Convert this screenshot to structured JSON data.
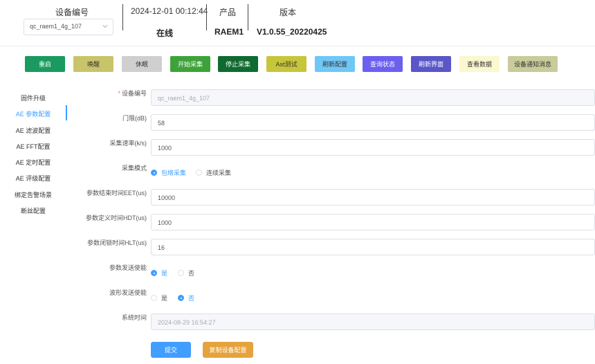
{
  "header": {
    "device_label": "设备编号",
    "device_select_value": "qc_raem1_4g_107",
    "timestamp": "2024-12-01 00:12:44",
    "status": "在线",
    "product_label": "产品",
    "product_value": "RAEM1",
    "version_label": "版本",
    "version_value": "V1.0.55_20220425"
  },
  "toolbar": {
    "buttons": [
      {
        "label": "重启",
        "bg": "#1a9a5f",
        "fg": "#ffffff"
      },
      {
        "label": "唤醒",
        "bg": "#c9c46a",
        "fg": "#333333"
      },
      {
        "label": "休眠",
        "bg": "#cfcfcf",
        "fg": "#333333"
      },
      {
        "label": "开始采集",
        "bg": "#3ea23a",
        "fg": "#ffffff"
      },
      {
        "label": "停止采集",
        "bg": "#0f6a2f",
        "fg": "#ffffff"
      },
      {
        "label": "Ast测试",
        "bg": "#c7c63a",
        "fg": "#333333"
      },
      {
        "label": "刷新配置",
        "bg": "#6fc7f6",
        "fg": "#333333"
      },
      {
        "label": "查询状态",
        "bg": "#6b5ff0",
        "fg": "#ffffff"
      },
      {
        "label": "刷新界面",
        "bg": "#5a56c8",
        "fg": "#ffffff"
      },
      {
        "label": "查看数据",
        "bg": "#fbf8cf",
        "fg": "#333333"
      },
      {
        "label": "设备通知消息",
        "bg": "#c8cb9a",
        "fg": "#333333"
      }
    ]
  },
  "sidebar": {
    "items": [
      {
        "label": "固件升级"
      },
      {
        "label": "AE 参数配置"
      },
      {
        "label": "AE 滤波配置"
      },
      {
        "label": "AE FFT配置"
      },
      {
        "label": "AE 定时配置"
      },
      {
        "label": "AE 评级配置"
      },
      {
        "label": "绑定告警场景"
      },
      {
        "label": "断丝配置"
      }
    ],
    "active_index": 1
  },
  "form": {
    "device_no": {
      "label": "设备编号",
      "value": "qc_raem1_4g_107"
    },
    "threshold": {
      "label": "门限(dB)",
      "value": "58"
    },
    "sample_rate": {
      "label": "采集速率(k/s)",
      "value": "1000"
    },
    "mode": {
      "label": "采集模式",
      "option_a": "包络采集",
      "option_b": "连续采集",
      "selected": "a"
    },
    "eet": {
      "label": "参数结束时间EET(us)",
      "value": "10000"
    },
    "hdt": {
      "label": "参数定义时间HDT(us)",
      "value": "1000"
    },
    "hlt": {
      "label": "参数闭锁时间HLT(us)",
      "value": "16"
    },
    "param_send": {
      "label": "参数发送使能",
      "option_a": "是",
      "option_b": "否",
      "selected": "a"
    },
    "wave_send": {
      "label": "波形发送使能",
      "option_a": "是",
      "option_b": "否",
      "selected": "b"
    },
    "system_time": {
      "label": "系统时间",
      "value": "2024-08-29 16:54:27"
    }
  },
  "actions": {
    "submit_label": "提交",
    "submit_color": "#409eff",
    "copy_label": "复制设备配置",
    "copy_color": "#e6a23c"
  }
}
